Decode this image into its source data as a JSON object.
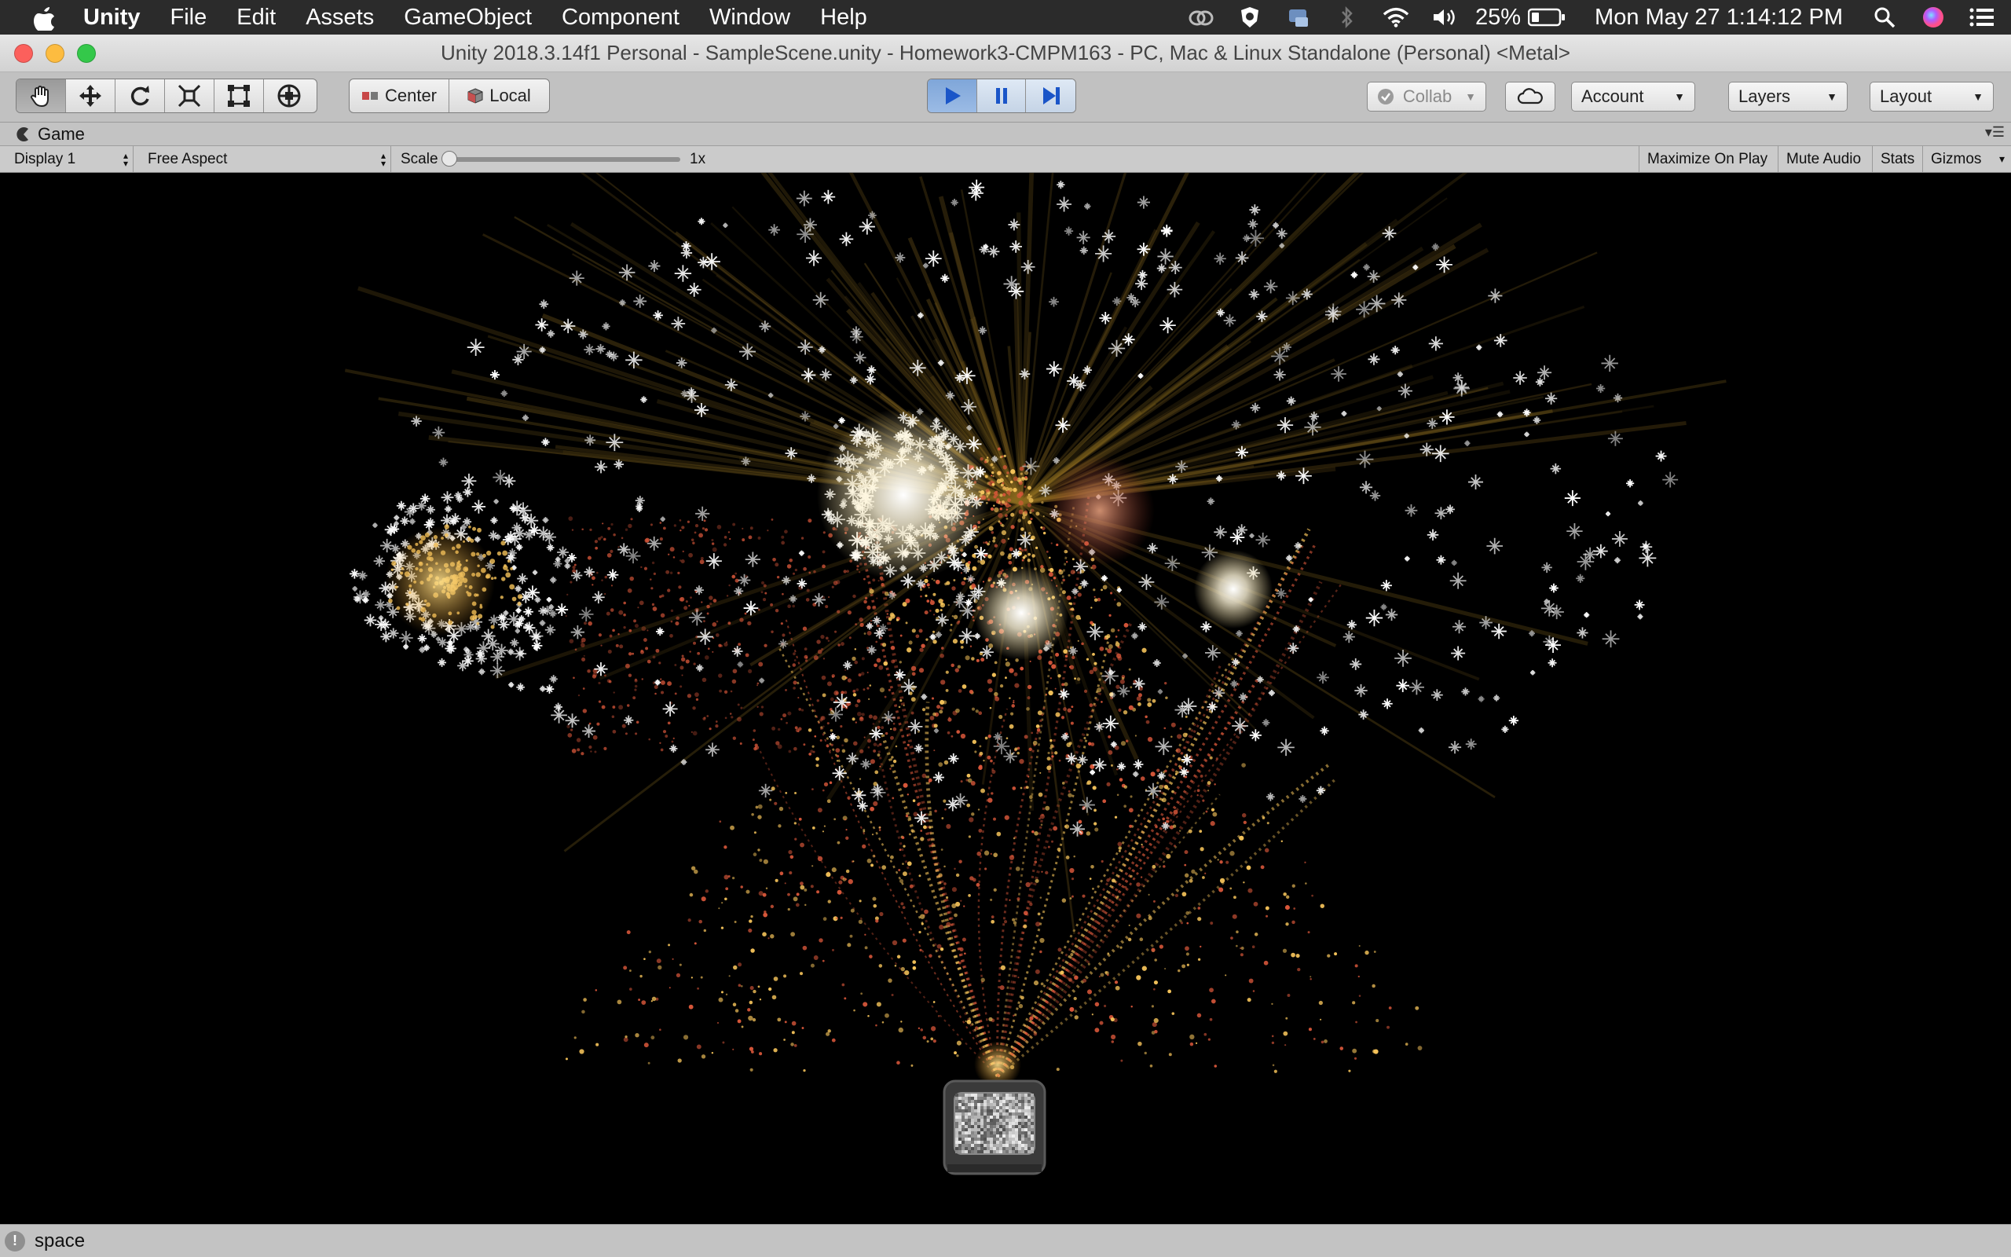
{
  "menubar": {
    "app": "Unity",
    "items": [
      "File",
      "Edit",
      "Assets",
      "GameObject",
      "Component",
      "Window",
      "Help"
    ],
    "battery": "25%",
    "clock": "Mon May 27  1:14:12 PM"
  },
  "window": {
    "title": "Unity 2018.3.14f1 Personal - SampleScene.unity - Homework3-CMPM163 - PC, Mac & Linux Standalone (Personal) <Metal>"
  },
  "toolbar": {
    "tools": [
      "hand-icon",
      "move-icon",
      "rotate-icon",
      "scale-icon",
      "rect-icon",
      "transform-icon"
    ],
    "pivot_label": "Center",
    "space_label": "Local",
    "collab_label": "Collab",
    "account_label": "Account",
    "layers_label": "Layers",
    "layout_label": "Layout"
  },
  "game_view": {
    "tab_label": "Game",
    "display": "Display 1",
    "aspect": "Free Aspect",
    "scale_label": "Scale",
    "scale_value": "1x",
    "maximize": "Maximize On Play",
    "mute": "Mute Audio",
    "stats": "Stats",
    "gizmos": "Gizmos"
  },
  "status": {
    "message": "space"
  },
  "colors": {
    "play_active": "#3f7fd8",
    "spark_white": "#ffffff",
    "spark_gold": "#f5c35a",
    "spark_red": "#d9573a"
  }
}
